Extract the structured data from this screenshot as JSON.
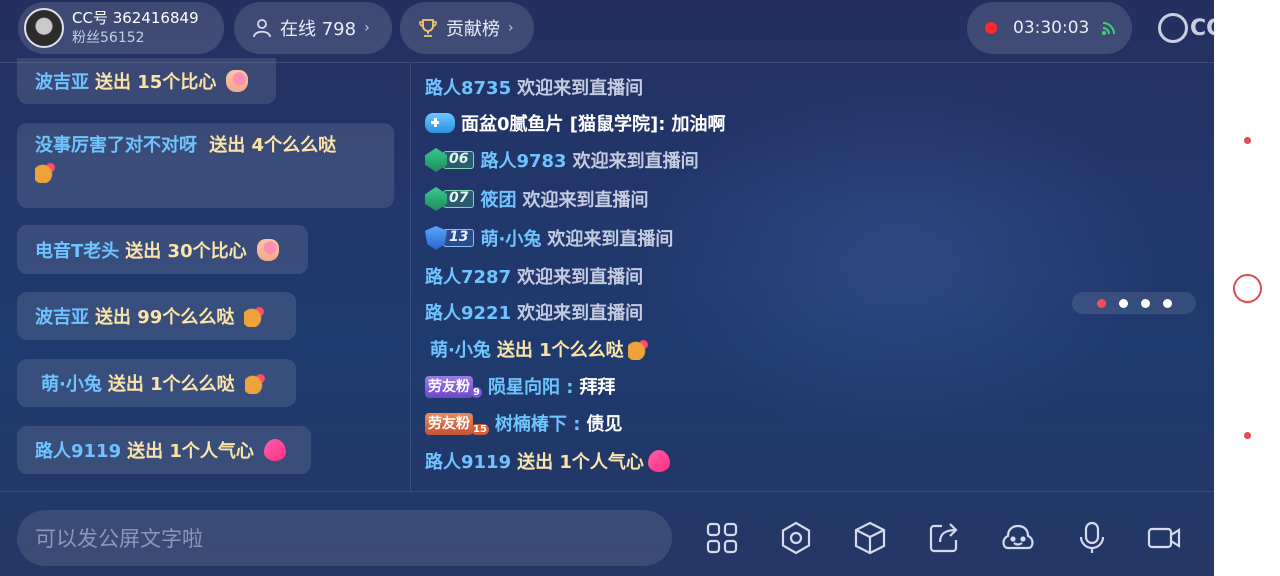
{
  "header": {
    "cc_id": "CC号 362416849",
    "fans": "粉丝56152",
    "online": "在线 798",
    "rank_label": "贡献榜",
    "timer": "03:30:03",
    "logo_text": "CC"
  },
  "gift_messages": [
    {
      "user": "波吉亚",
      "text": "送出 15个比心"
    },
    {
      "user": "没事厉害了对不对呀",
      "text": "送出 4个么么哒"
    },
    {
      "user": "电音T老头",
      "text": "送出 30个比心"
    },
    {
      "user": "波吉亚",
      "text": "送出 99个么么哒"
    },
    {
      "user": "萌·小兔",
      "text": "送出 1个么么哒"
    },
    {
      "user": "路人9119",
      "text": "送出 1个人气心"
    }
  ],
  "chat": [
    {
      "user": "路人8735",
      "text": "欢迎来到直播间"
    },
    {
      "user": "面盆0腻鱼片 [猫鼠学院]:",
      "text": "加油啊"
    },
    {
      "badge": "06",
      "user": "路人9783",
      "text": "欢迎来到直播间"
    },
    {
      "badge": "07",
      "user": "筱团",
      "text": "欢迎来到直播间"
    },
    {
      "badge": "13",
      "user": "萌·小兔",
      "text": "欢迎来到直播间"
    },
    {
      "user": "路人7287",
      "text": "欢迎来到直播间"
    },
    {
      "user": "路人9221",
      "text": "欢迎来到直播间"
    },
    {
      "user": "萌·小兔",
      "text": "送出 1个么么哒"
    },
    {
      "fan_badge": "劳友粉",
      "fan_level": "9",
      "user": "陨星向阳 :",
      "text": "拜拜"
    },
    {
      "fan_badge": "劳友粉",
      "fan_level": "15",
      "user": "树楠椿下 :",
      "text": "债见"
    },
    {
      "user": "路人9119",
      "text": "送出 1个人气心"
    }
  ],
  "input": {
    "placeholder": "可以发公屏文字啦"
  },
  "toolbar": [
    "grid-icon",
    "settings-icon",
    "box-icon",
    "share-icon",
    "game-icon",
    "mic-icon",
    "camera-icon"
  ],
  "carousel": {
    "count": 4,
    "active_index": 0
  },
  "colors": {
    "username": "#6fc3ff",
    "gift_text": "#fbe4a8",
    "accent_red": "#ff2a2a"
  }
}
